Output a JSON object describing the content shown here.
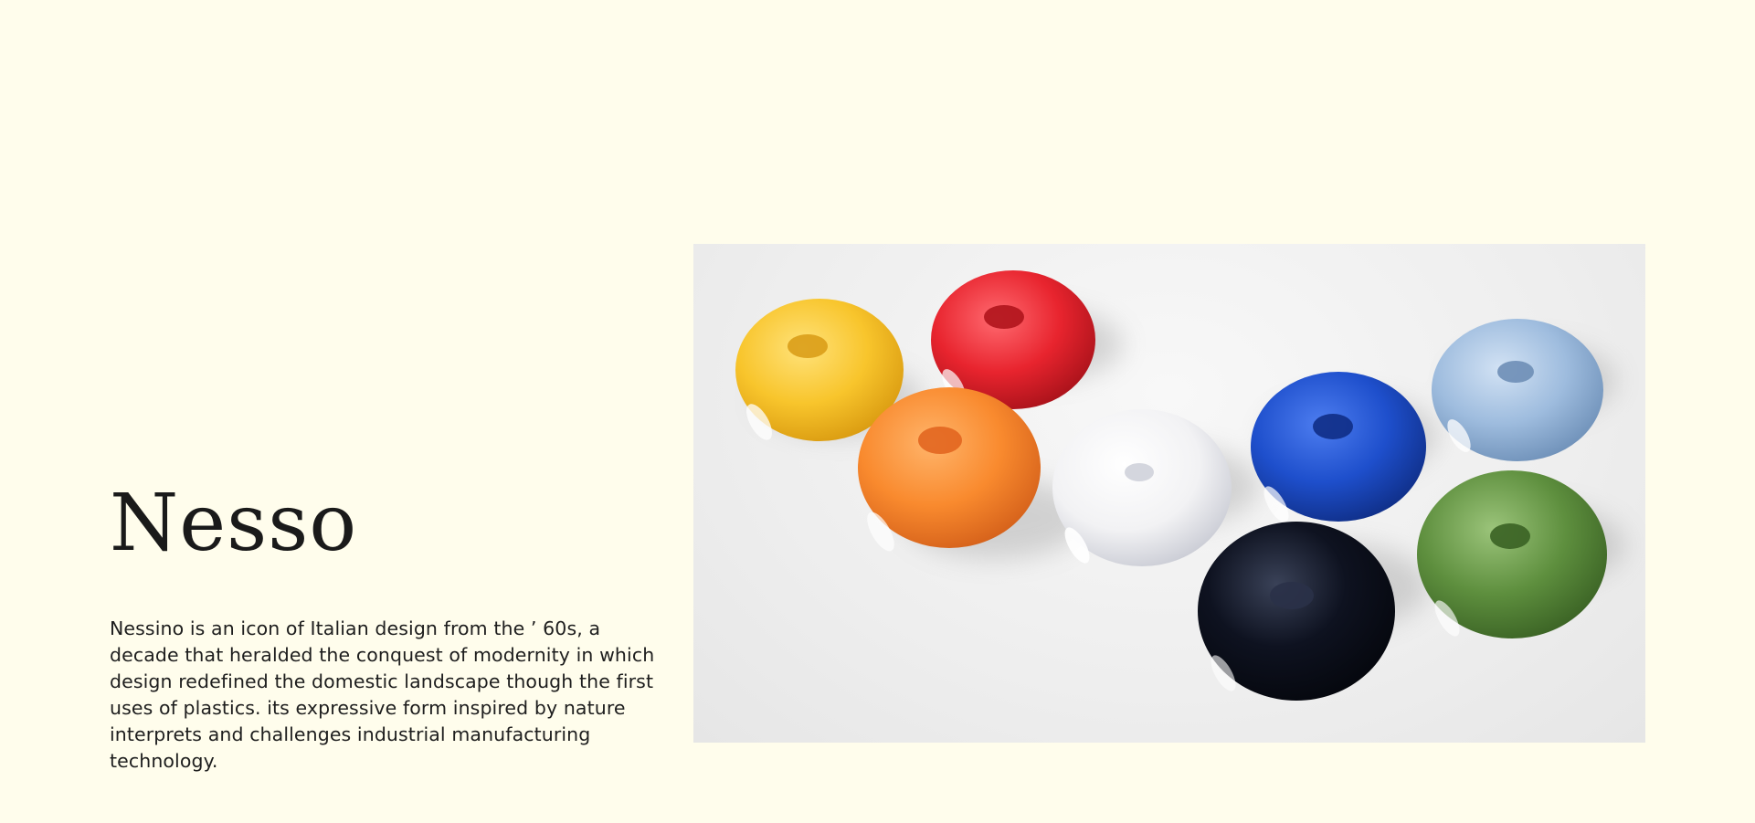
{
  "product": {
    "title": "Nesso",
    "description": "Nessino is an icon of Italian design from the ’ 60s, a decade that heralded the conquest of modernity in which design redefined the domestic landscape though the first uses of plastics. its expressive form inspired by nature interprets and challenges industrial manufacturing technology."
  },
  "colors": {
    "background": "#FFFDEC",
    "yellow": "#F8C52C",
    "red": "#E8242E",
    "orange": "#F98A2E",
    "white": "#F2F2F4",
    "blue": "#1E4FCC",
    "light_blue": "#9EBCDE",
    "black": "#0E1220",
    "green": "#5E8F3E"
  }
}
